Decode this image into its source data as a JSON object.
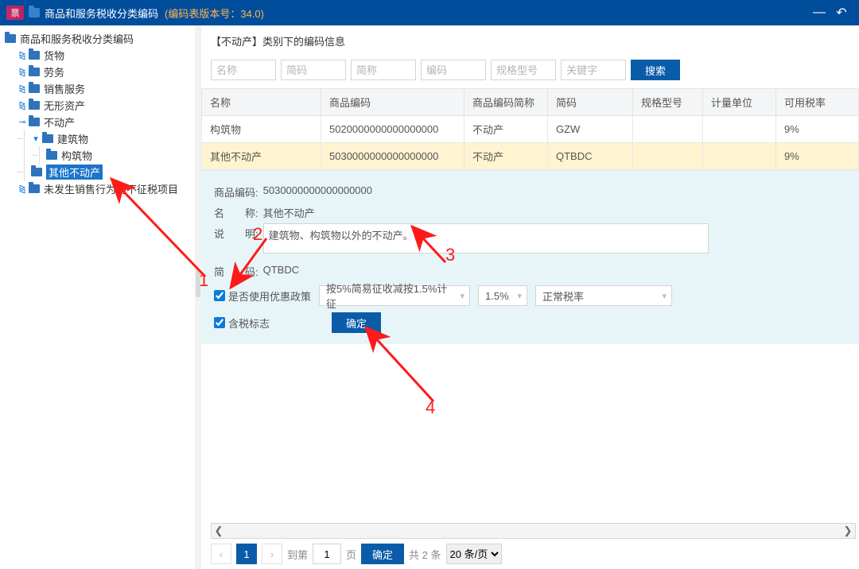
{
  "titlebar": {
    "logo_text": "票",
    "title": "商品和服务税收分类编码",
    "version": "(编码表版本号：34.0)"
  },
  "tree": {
    "root": "商品和服务税收分类编码",
    "n1": "货物",
    "n2": "劳务",
    "n3": "销售服务",
    "n4": "无形资产",
    "n5": "不动产",
    "n5a": "建筑物",
    "n5a1": "构筑物",
    "n5b": "其他不动产",
    "n6": "未发生销售行为的不征税项目"
  },
  "section": {
    "heading": "【不动产】类别下的编码信息"
  },
  "search": {
    "ph1": "名称",
    "ph2": "简码",
    "ph3": "简称",
    "ph4": "编码",
    "ph5": "规格型号",
    "ph6": "关键字",
    "btn": "搜索"
  },
  "table": {
    "h1": "名称",
    "h2": "商品编码",
    "h3": "商品编码简称",
    "h4": "简码",
    "h5": "规格型号",
    "h6": "计量单位",
    "h7": "可用税率",
    "r1c1": "构筑物",
    "r1c2": "5020000000000000000",
    "r1c3": "不动产",
    "r1c4": "GZW",
    "r1c7": "9%",
    "r2c1": "其他不动产",
    "r2c2": "5030000000000000000",
    "r2c3": "不动产",
    "r2c4": "QTBDC",
    "r2c7": "9%"
  },
  "detail": {
    "code_lbl": "商品编码:",
    "code_val": "5030000000000000000",
    "name_lbl": "名　　称:",
    "name_val": "其他不动产",
    "desc_lbl": "说　　明:",
    "desc_val": "建筑物、构筑物以外的不动产。",
    "short_lbl": "简　　码:",
    "short_val": "QTBDC",
    "use_pref": "是否使用优惠政策",
    "policy": "按5%简易征收减按1.5%计征",
    "rate": "1.5%",
    "rate_type": "正常税率",
    "tax_flag": "含税标志",
    "confirm": "确定"
  },
  "pager": {
    "goto": "到第",
    "page_unit": "页",
    "confirm": "确定",
    "total": "共 2 条",
    "per": "20 条/页",
    "cur": "1",
    "input": "1"
  },
  "anno": {
    "n1": "1",
    "n2": "2",
    "n3": "3",
    "n4": "4"
  }
}
